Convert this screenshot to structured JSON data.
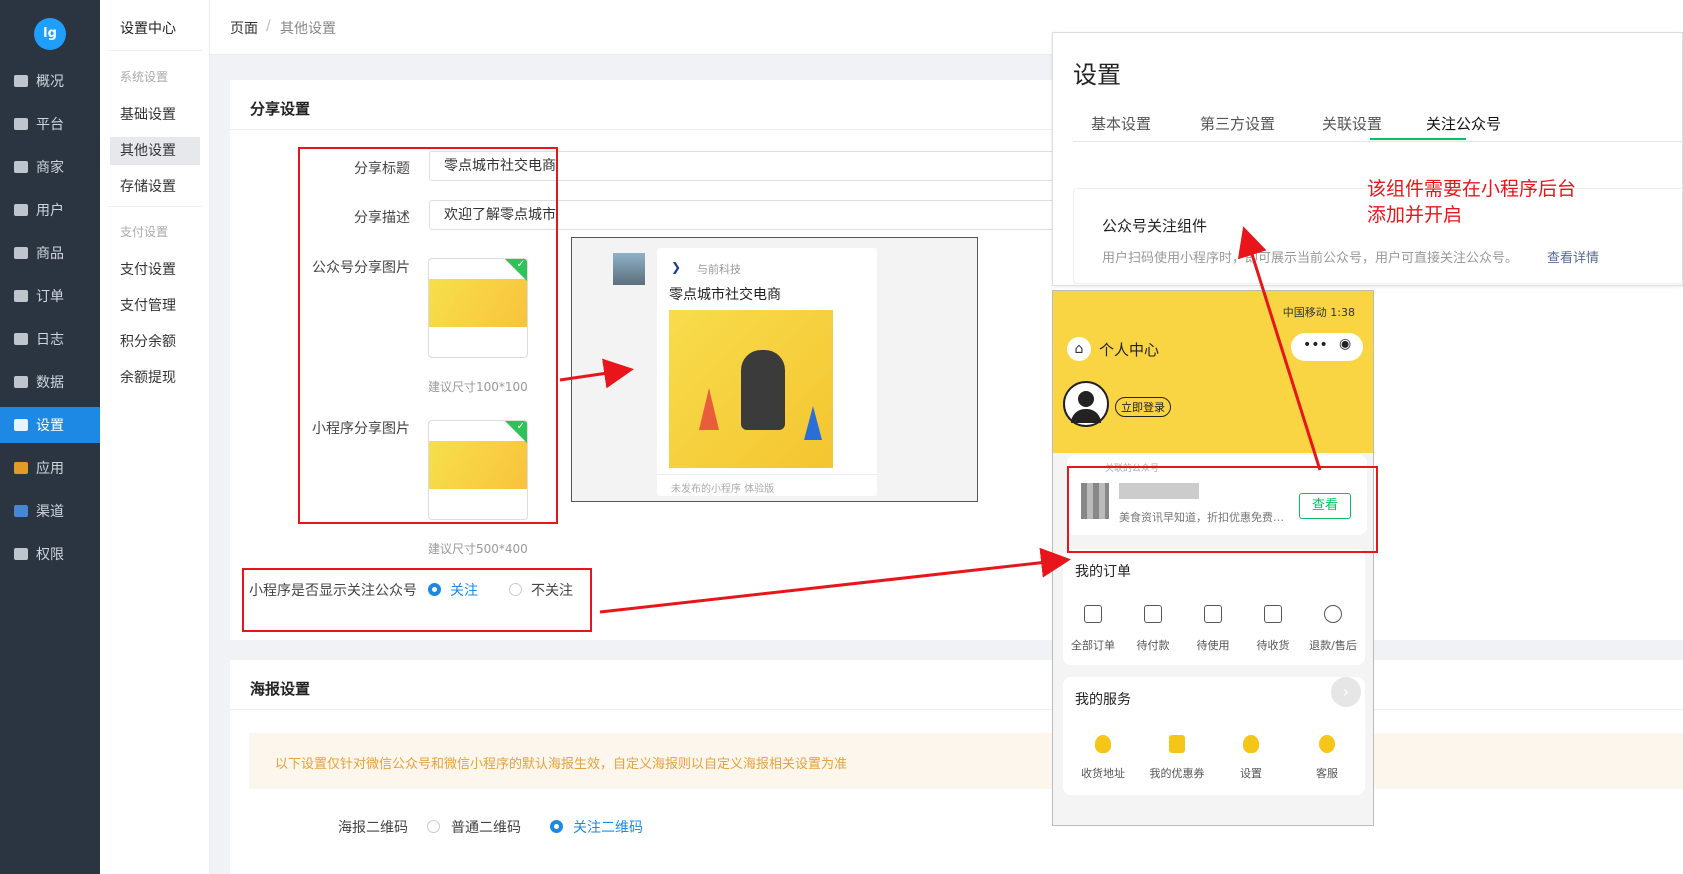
{
  "app": {
    "logo_text": "lg"
  },
  "sidebar": {
    "items": [
      {
        "label": "概况",
        "icon": "chart-icon"
      },
      {
        "label": "平台",
        "icon": "monitor-icon"
      },
      {
        "label": "商家",
        "icon": "shop-icon"
      },
      {
        "label": "用户",
        "icon": "user-icon"
      },
      {
        "label": "商品",
        "icon": "goods-icon"
      },
      {
        "label": "订单",
        "icon": "order-icon"
      },
      {
        "label": "日志",
        "icon": "log-icon"
      },
      {
        "label": "数据",
        "icon": "bar-chart-icon"
      },
      {
        "label": "设置",
        "icon": "gear-icon",
        "active": true
      },
      {
        "label": "应用",
        "icon": "apps-icon"
      },
      {
        "label": "渠道",
        "icon": "cube-icon"
      },
      {
        "label": "权限",
        "icon": "lock-icon"
      }
    ]
  },
  "subnav": {
    "title": "设置中心",
    "group1": "系统设置",
    "group1_items": [
      "基础设置",
      "其他设置",
      "存储设置"
    ],
    "group2": "支付设置",
    "group2_items": [
      "支付设置",
      "支付管理",
      "积分余额",
      "余额提现"
    ]
  },
  "breadcrumb": {
    "root": "页面",
    "sep": "/",
    "current": "其他设置"
  },
  "share": {
    "title": "分享设置",
    "title_label": "分享标题",
    "title_value": "零点城市社交电商",
    "desc_label": "分享描述",
    "desc_value": "欢迎了解零点城市",
    "mp_img_label": "公众号分享图片",
    "mp_img_hint": "建议尺寸100*100",
    "mini_img_label": "小程序分享图片",
    "mini_img_hint": "建议尺寸500*400",
    "follow_label": "小程序是否显示关注公众号",
    "follow_on": "关注",
    "follow_off": "不关注"
  },
  "preview": {
    "brand": "与前科技",
    "title": "零点城市社交电商",
    "footer": "未发布的小程序 体验版"
  },
  "poster": {
    "title": "海报设置",
    "notice": "以下设置仅针对微信公众号和微信小程序的默认海报生效，自定义海报则以自定义海报相关设置为准",
    "qr_label": "海报二维码",
    "qr_opt1": "普通二维码",
    "qr_opt2": "关注二维码"
  },
  "settings_popup": {
    "title": "设置",
    "tabs": [
      "基本设置",
      "第三方设置",
      "关联设置",
      "关注公众号"
    ],
    "component_title": "公众号关注组件",
    "component_desc": "用户扫码使用小程序时，即可展示当前公众号，用户可直接关注公众号。",
    "component_link": "查看详情"
  },
  "annotation": "该组件需要在小程序后台添加并开启",
  "phone": {
    "status": "中国移动 1:38",
    "title": "个人中心",
    "login": "立即登录",
    "related_label": "关联的公众号",
    "related_desc": "美食资讯早知道，折扣优惠免费…",
    "view_btn": "查看",
    "orders_title": "我的订单",
    "orders": [
      "全部订单",
      "待付款",
      "待使用",
      "待收货",
      "退款/售后"
    ],
    "services_title": "我的服务",
    "services": [
      "收货地址",
      "我的优惠券",
      "设置",
      "客服"
    ]
  }
}
